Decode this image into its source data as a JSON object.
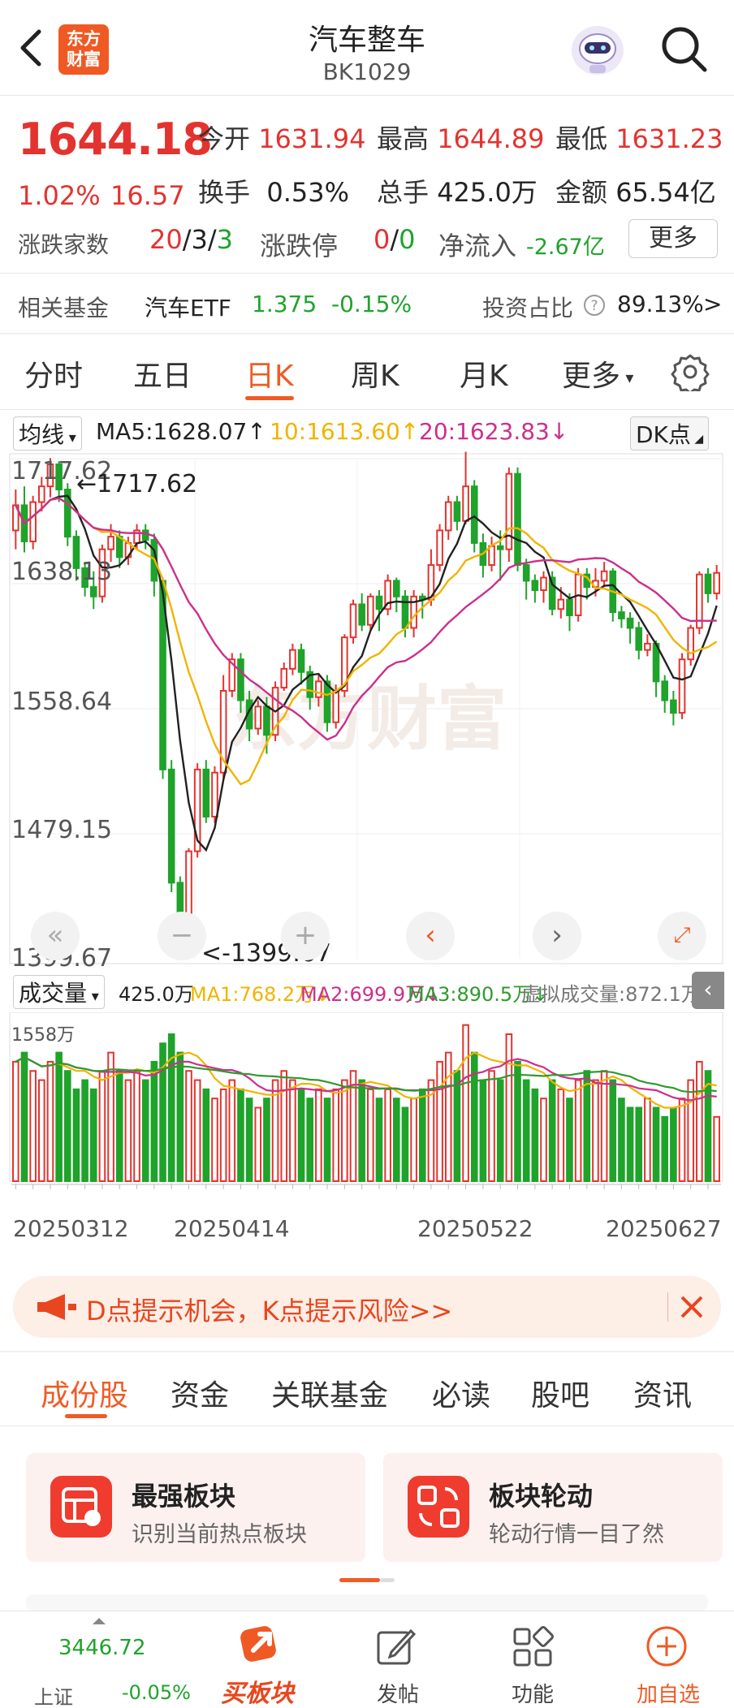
{
  "header": {
    "title": "汽车整车",
    "code": "BK1029",
    "logo_text": "东方财富"
  },
  "quote": {
    "price": "1644.18",
    "change_pct": "1.02%",
    "change": "16.57",
    "open_label": "今开",
    "open": "1631.94",
    "high_label": "最高",
    "high": "1644.89",
    "low_label": "最低",
    "low": "1631.23",
    "turnover_label": "换手",
    "turnover": "0.53%",
    "volume_label": "总手",
    "volume": "425.0万",
    "amount_label": "金额",
    "amount": "65.54亿",
    "updown_label": "涨跌家数",
    "up": "20",
    "flat": "3",
    "down": "3",
    "limit_label": "涨跌停",
    "limit_up": "0",
    "limit_down": "0",
    "netflow_label": "净流入",
    "netflow": "-2.67亿",
    "more_label": "更多"
  },
  "fund": {
    "label": "相关基金",
    "name": "汽车ETF",
    "price": "1.375",
    "change": "-0.15%",
    "ratio_label": "投资占比",
    "ratio": "89.13%",
    "arrow": ">"
  },
  "ktabs": [
    "分时",
    "五日",
    "日K",
    "周K",
    "月K",
    "更多"
  ],
  "chart": {
    "ma_select": "均线",
    "ma5": "MA5:1628.07",
    "ma10": "10:1613.60",
    "ma20": "20:1623.83",
    "dk": "DK点",
    "yticks": [
      "1717.62",
      "1638.13",
      "1558.64",
      "1479.15",
      "1399.67"
    ],
    "high_marker": "1717.62",
    "low_marker": "1399.67",
    "watermark": "东方财富",
    "vol_select": "成交量",
    "vol": "425.0万",
    "vma1": "MA1:768.2万",
    "vma2": "MA2:699.9万",
    "vma3": "MA3:890.5万",
    "vvirtual": "虚拟成交量:872.1万",
    "vol_max": "1558万",
    "dates": [
      "20250312",
      "20250414",
      "20250522",
      "20250627"
    ],
    "colors": {
      "up": "#e3332f",
      "down": "#1fa32b",
      "ma5": "#222222",
      "ma10": "#f0b400",
      "ma20": "#cc2f8c",
      "vma3": "#2f9a2f"
    }
  },
  "chart_data": {
    "type": "candlestick",
    "ylim": [
      1399.67,
      1717.62
    ],
    "candles": [
      [
        1672,
        1688,
        1660,
        1698
      ],
      [
        1688,
        1665,
        1658,
        1700
      ],
      [
        1665,
        1690,
        1660,
        1694
      ],
      [
        1690,
        1700,
        1684,
        1706
      ],
      [
        1700,
        1714,
        1693,
        1718
      ],
      [
        1714,
        1698,
        1690,
        1716
      ],
      [
        1698,
        1668,
        1662,
        1702
      ],
      [
        1668,
        1648,
        1640,
        1672
      ],
      [
        1648,
        1636,
        1630,
        1652
      ],
      [
        1636,
        1630,
        1622,
        1646
      ],
      [
        1630,
        1660,
        1626,
        1663
      ],
      [
        1660,
        1668,
        1652,
        1676
      ],
      [
        1668,
        1655,
        1648,
        1672
      ],
      [
        1655,
        1664,
        1650,
        1668
      ],
      [
        1664,
        1672,
        1660,
        1676
      ],
      [
        1672,
        1666,
        1660,
        1676
      ],
      [
        1666,
        1640,
        1630,
        1670
      ],
      [
        1640,
        1520,
        1514,
        1642
      ],
      [
        1520,
        1448,
        1442,
        1526
      ],
      [
        1448,
        1418,
        1402,
        1452
      ],
      [
        1418,
        1468,
        1414,
        1470
      ],
      [
        1468,
        1520,
        1464,
        1524
      ],
      [
        1520,
        1490,
        1486,
        1526
      ],
      [
        1490,
        1518,
        1486,
        1522
      ],
      [
        1518,
        1570,
        1514,
        1580
      ],
      [
        1570,
        1590,
        1566,
        1594
      ],
      [
        1590,
        1564,
        1556,
        1594
      ],
      [
        1564,
        1546,
        1538,
        1570
      ],
      [
        1546,
        1560,
        1542,
        1564
      ],
      [
        1560,
        1542,
        1530,
        1566
      ],
      [
        1542,
        1572,
        1538,
        1576
      ],
      [
        1572,
        1584,
        1570,
        1588
      ],
      [
        1584,
        1596,
        1580,
        1600
      ],
      [
        1596,
        1582,
        1574,
        1600
      ],
      [
        1582,
        1566,
        1558,
        1586
      ],
      [
        1566,
        1576,
        1560,
        1580
      ],
      [
        1576,
        1550,
        1544,
        1580
      ],
      [
        1550,
        1570,
        1546,
        1574
      ],
      [
        1570,
        1604,
        1566,
        1606
      ],
      [
        1604,
        1625,
        1600,
        1628
      ],
      [
        1625,
        1612,
        1608,
        1632
      ],
      [
        1612,
        1630,
        1608,
        1632
      ],
      [
        1630,
        1622,
        1608,
        1634
      ],
      [
        1622,
        1640,
        1618,
        1644
      ],
      [
        1640,
        1630,
        1620,
        1642
      ],
      [
        1630,
        1610,
        1604,
        1634
      ],
      [
        1610,
        1630,
        1604,
        1634
      ],
      [
        1630,
        1628,
        1616,
        1632
      ],
      [
        1628,
        1650,
        1624,
        1660
      ],
      [
        1650,
        1672,
        1646,
        1676
      ],
      [
        1672,
        1690,
        1666,
        1694
      ],
      [
        1690,
        1678,
        1672,
        1694
      ],
      [
        1678,
        1700,
        1676,
        1722
      ],
      [
        1700,
        1664,
        1658,
        1704
      ],
      [
        1664,
        1650,
        1642,
        1670
      ],
      [
        1650,
        1662,
        1646,
        1668
      ],
      [
        1662,
        1660,
        1640,
        1672
      ],
      [
        1660,
        1708,
        1652,
        1712
      ],
      [
        1708,
        1650,
        1646,
        1712
      ],
      [
        1650,
        1640,
        1628,
        1654
      ],
      [
        1640,
        1634,
        1626,
        1644
      ],
      [
        1634,
        1642,
        1626,
        1646
      ],
      [
        1642,
        1622,
        1618,
        1646
      ],
      [
        1622,
        1628,
        1616,
        1636
      ],
      [
        1628,
        1618,
        1608,
        1632
      ],
      [
        1618,
        1644,
        1614,
        1648
      ],
      [
        1644,
        1636,
        1628,
        1648
      ],
      [
        1636,
        1640,
        1630,
        1648
      ],
      [
        1640,
        1646,
        1636,
        1652
      ],
      [
        1646,
        1620,
        1614,
        1648
      ],
      [
        1620,
        1616,
        1610,
        1624
      ],
      [
        1616,
        1610,
        1600,
        1620
      ],
      [
        1610,
        1596,
        1590,
        1614
      ],
      [
        1596,
        1600,
        1592,
        1606
      ],
      [
        1600,
        1576,
        1566,
        1602
      ],
      [
        1576,
        1564,
        1556,
        1580
      ],
      [
        1564,
        1556,
        1548,
        1570
      ],
      [
        1556,
        1590,
        1552,
        1594
      ],
      [
        1590,
        1610,
        1586,
        1612
      ],
      [
        1610,
        1644,
        1606,
        1646
      ],
      [
        1644,
        1632,
        1626,
        1648
      ],
      [
        1632,
        1645,
        1628,
        1650
      ]
    ],
    "volumes": [
      13,
      14,
      12,
      11,
      13,
      14,
      12,
      10,
      11,
      10,
      12,
      14,
      12,
      11,
      12,
      11,
      13,
      15,
      16,
      14,
      12,
      11,
      10,
      9,
      10,
      11,
      10,
      9,
      8,
      9,
      11,
      12,
      11,
      10,
      9,
      10,
      9,
      10,
      11,
      12,
      11,
      10,
      9,
      10,
      9,
      8,
      9,
      10,
      11,
      13,
      14,
      12,
      17,
      14,
      11,
      12,
      11,
      16,
      13,
      11,
      10,
      9,
      11,
      10,
      9,
      11,
      12,
      11,
      12,
      11,
      9,
      8,
      8,
      9,
      8,
      7,
      8,
      9,
      11,
      13,
      12,
      7
    ]
  },
  "banner": {
    "text": "D点提示机会，K点提示风险>>"
  },
  "subtabs": [
    "成份股",
    "资金",
    "关联基金",
    "必读",
    "股吧",
    "资讯"
  ],
  "cards": [
    {
      "title": "最强板块",
      "subtitle": "识别当前热点板块"
    },
    {
      "title": "板块轮动",
      "subtitle": "轮动行情一目了然"
    }
  ],
  "nav": {
    "index_value": "3446.72",
    "index_label": "上证",
    "index_change": "-0.05%",
    "buy": "买板块",
    "post": "发帖",
    "func": "功能",
    "add": "加自选"
  }
}
